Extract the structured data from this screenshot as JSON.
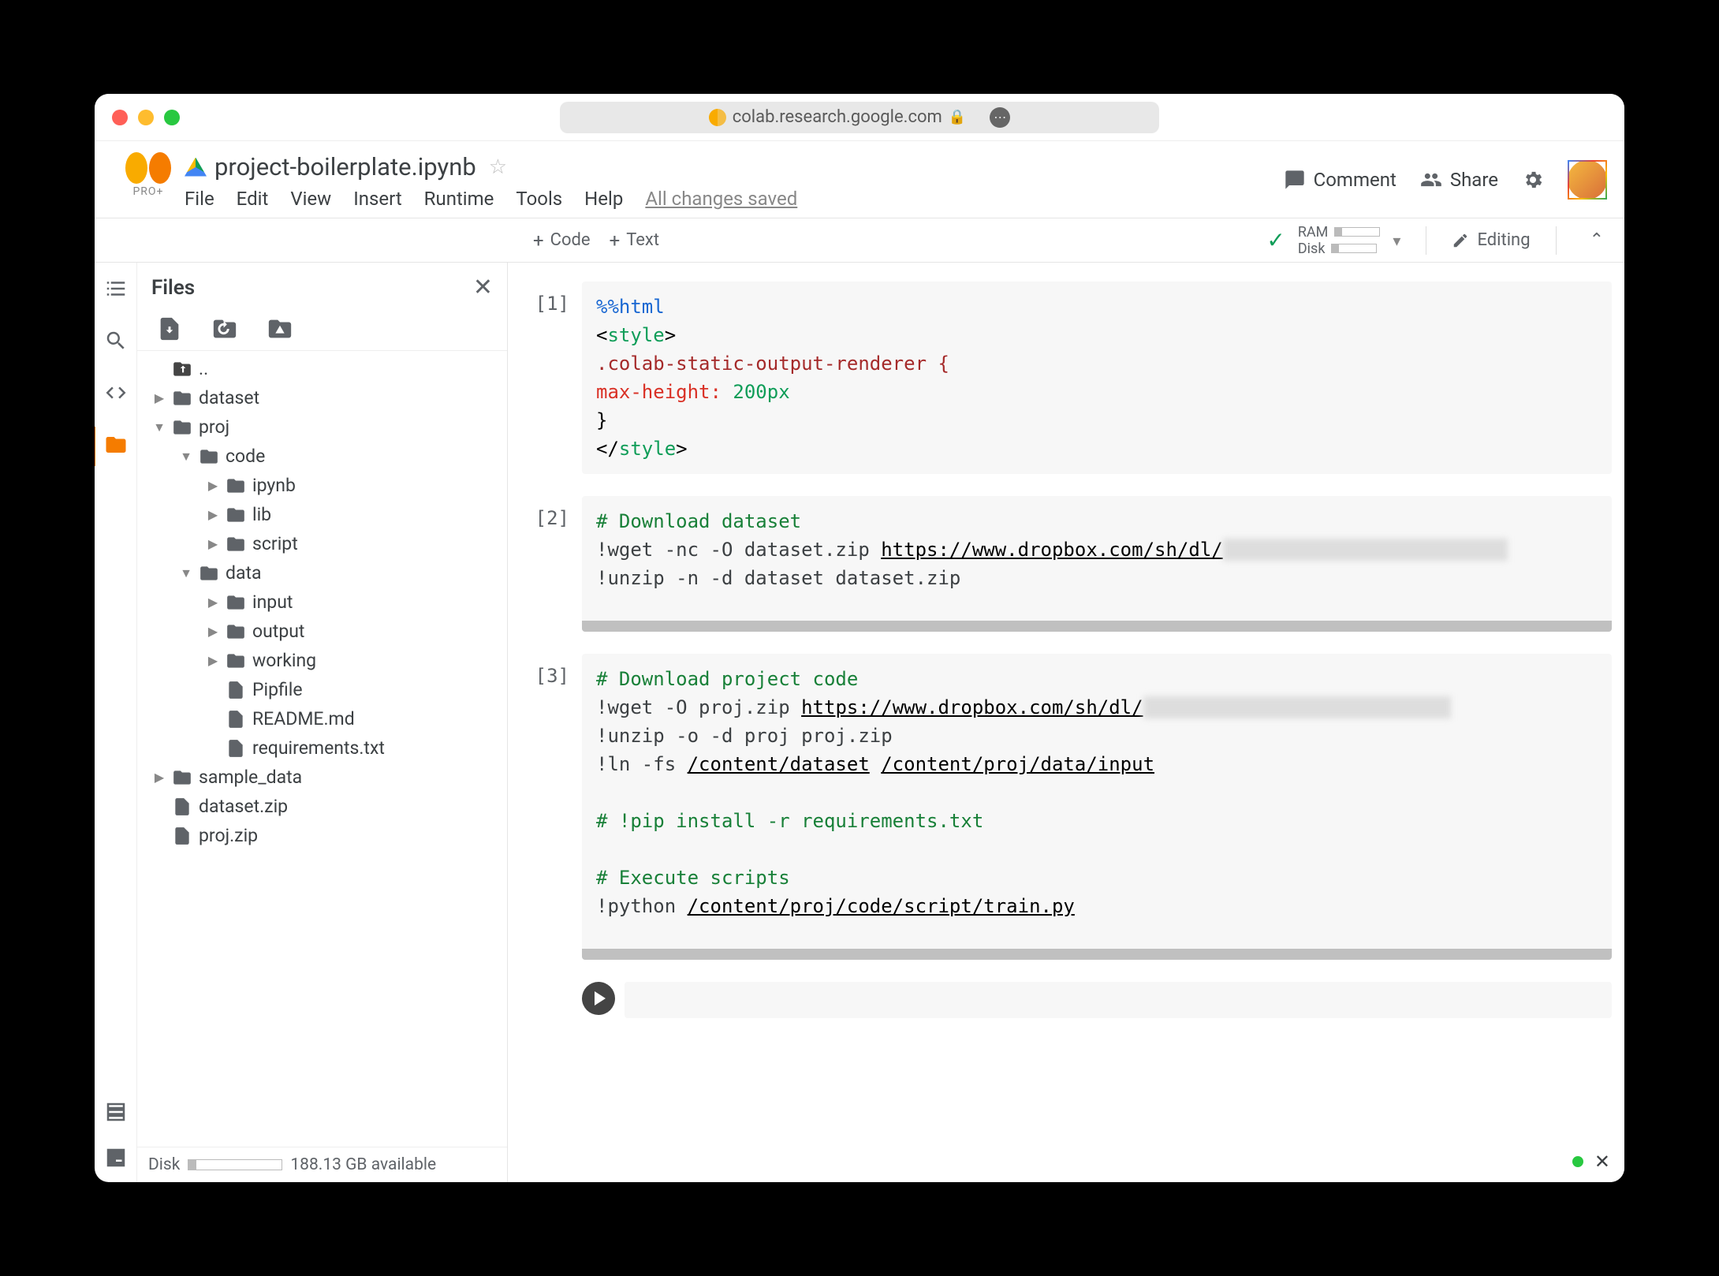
{
  "browser": {
    "url": "colab.research.google.com"
  },
  "header": {
    "logo_sub": "PRO+",
    "notebook_title": "project-boilerplate.ipynb",
    "menu": [
      "File",
      "Edit",
      "View",
      "Insert",
      "Runtime",
      "Tools",
      "Help"
    ],
    "saved": "All changes saved",
    "comment": "Comment",
    "share": "Share"
  },
  "toolbar": {
    "code": "Code",
    "text": "Text",
    "ram": "RAM",
    "disk": "Disk",
    "editing": "Editing"
  },
  "filepanel": {
    "title": "Files",
    "tree": {
      "up": "..",
      "dataset": "dataset",
      "proj": "proj",
      "code": "code",
      "ipynb": "ipynb",
      "lib": "lib",
      "script": "script",
      "data": "data",
      "input": "input",
      "output": "output",
      "working": "working",
      "pipfile": "Pipfile",
      "readme": "README.md",
      "reqs": "requirements.txt",
      "sample_data": "sample_data",
      "dsz": "dataset.zip",
      "pz": "proj.zip"
    },
    "footer_label": "Disk",
    "footer_avail": "188.13 GB available"
  },
  "cells": {
    "n1": "[1]",
    "n2": "[2]",
    "n3": "[3]",
    "c1_magic": "%%html",
    "c1_l2a": "<",
    "c1_l2b": "style",
    "c1_l2c": ">",
    "c1_l3": ".colab-static-output-renderer {",
    "c1_l4a": "  max-height:",
    "c1_l4b": " 200px",
    "c1_l5": "  }",
    "c1_l6a": "</",
    "c1_l6b": "style",
    "c1_l6c": ">",
    "c2_l1": "# Download dataset",
    "c2_l2a": "!wget -nc -O dataset.zip ",
    "c2_l2b": "https://www.dropbox.com/sh/dl/",
    "c2_l2blur": "xxxxxxxxxxxxxxxxxxxxxxxxx",
    "c2_l3": "!unzip -n -d dataset dataset.zip",
    "c3_l1": "# Download project code",
    "c3_l2a": "!wget -O proj.zip ",
    "c3_l2b": "https://www.dropbox.com/sh/dl/",
    "c3_l2blur": "xxxxxxxxxxxxxxxxxxxxxxxxxxx",
    "c3_l3": "!unzip -o -d proj proj.zip",
    "c3_l4a": "!ln -fs ",
    "c3_l4b": "/content/dataset",
    "c3_l4c": " ",
    "c3_l4d": "/content/proj/data/input",
    "c3_l5": "# !pip install -r requirements.txt",
    "c3_l6": "# Execute scripts",
    "c3_l7a": "!python ",
    "c3_l7b": "/content/proj/code/script/train.py"
  }
}
